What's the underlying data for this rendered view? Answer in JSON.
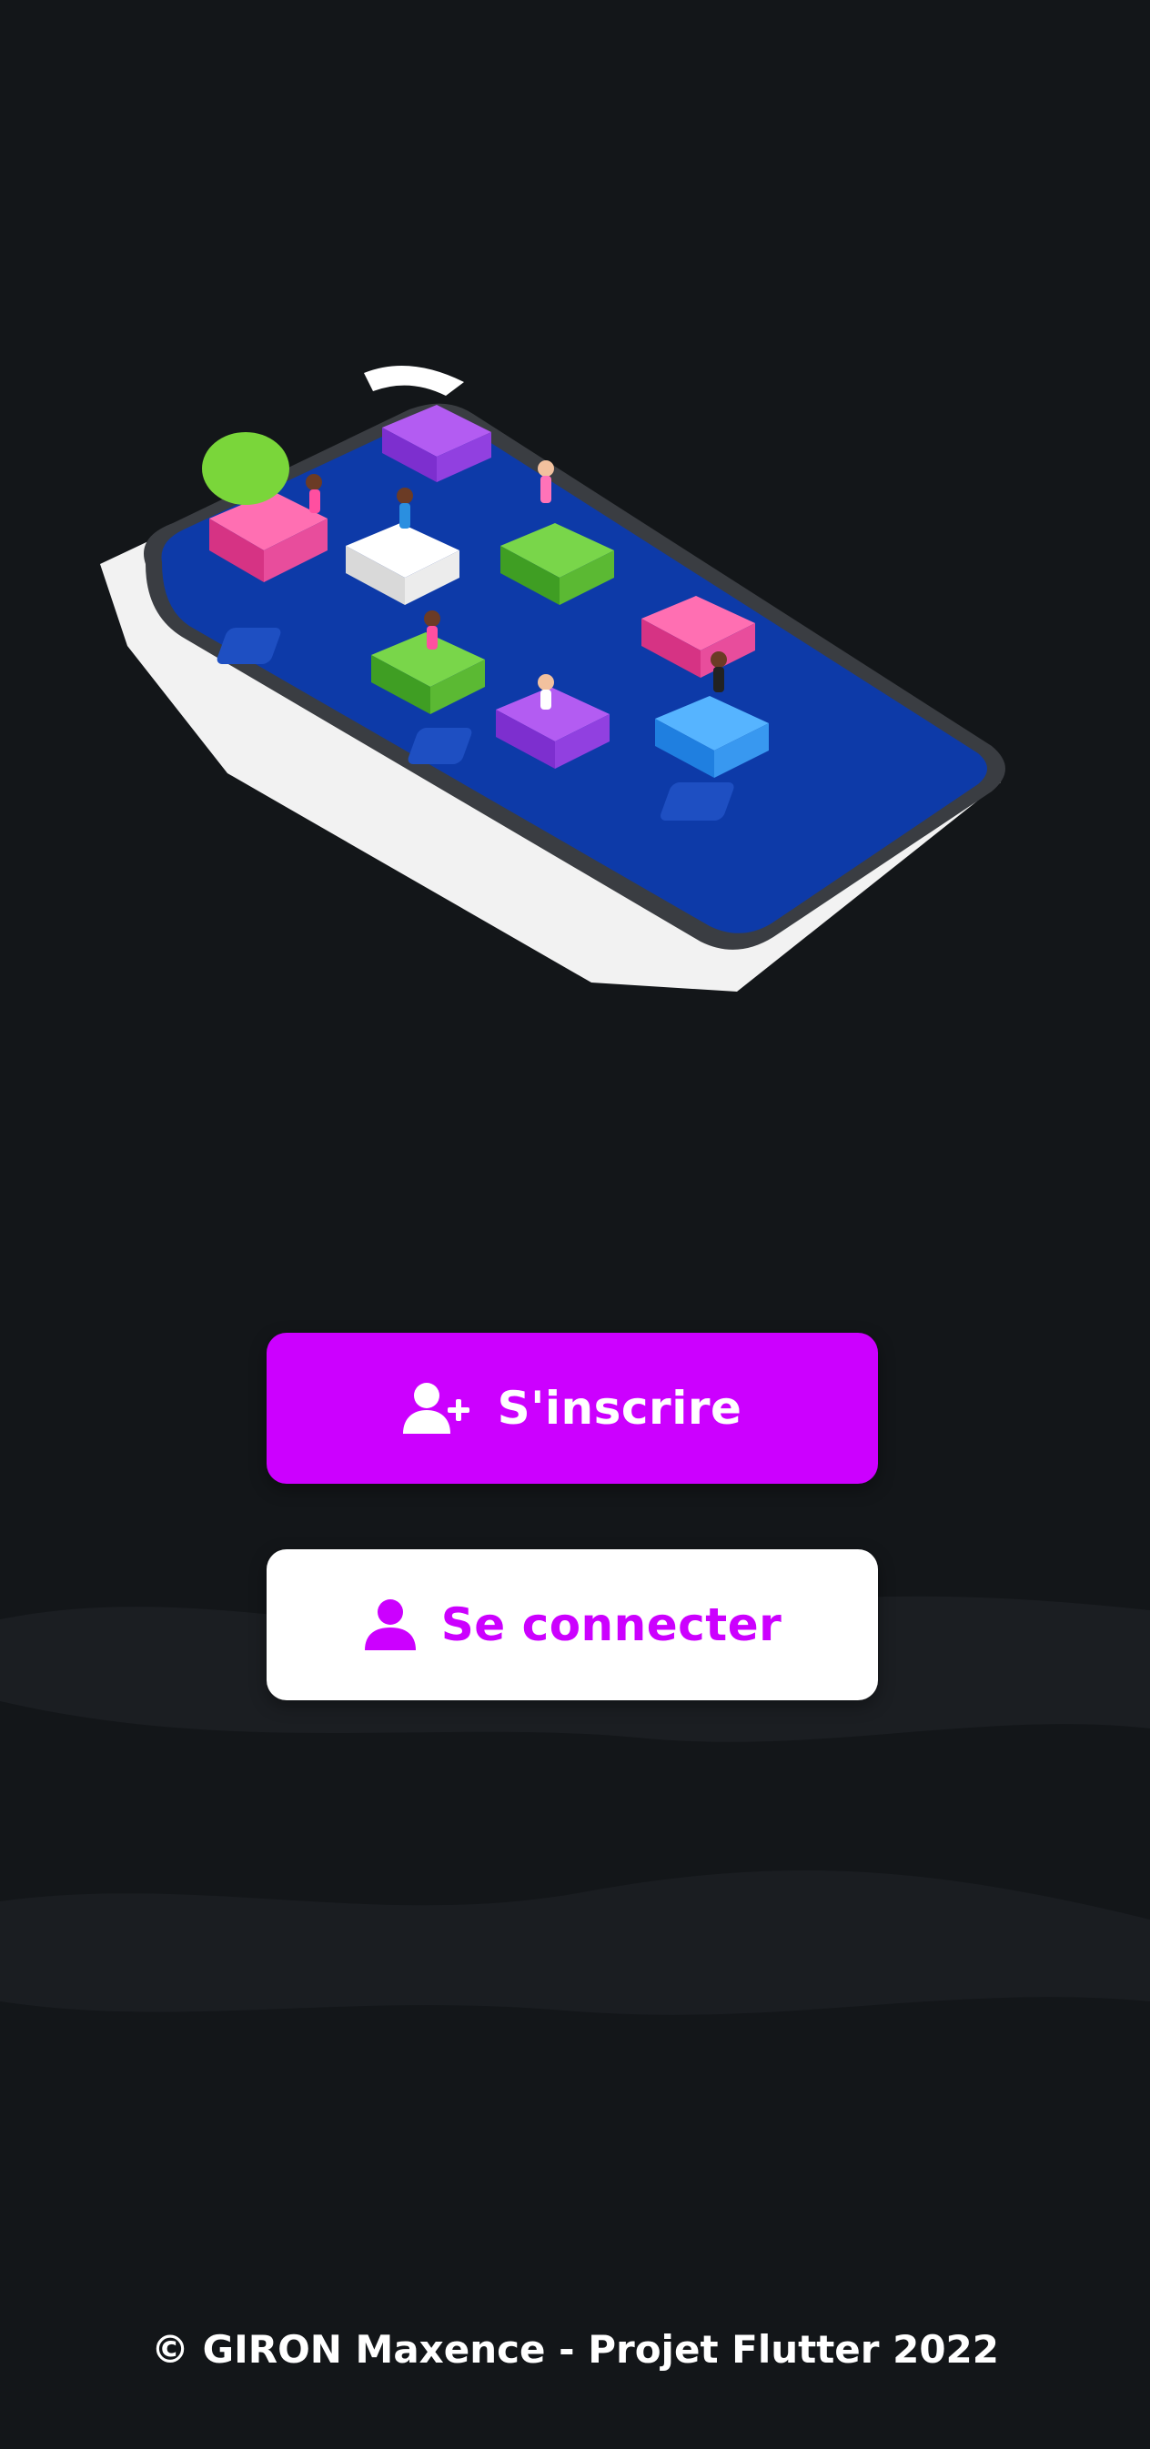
{
  "hero": {
    "illustration": "isometric-phone-with-app-blocks"
  },
  "actions": {
    "signup": {
      "label": "S'inscrire",
      "icon": "user-plus-icon",
      "background": "#cc00ff",
      "text_color": "#ffffff"
    },
    "login": {
      "label": "Se connecter",
      "icon": "user-icon",
      "background": "#ffffff",
      "text_color": "#cc00ff"
    }
  },
  "footer": {
    "text": "© GIRON Maxence - Projet Flutter 2022"
  },
  "colors": {
    "background": "#131619",
    "accent": "#cc00ff"
  }
}
